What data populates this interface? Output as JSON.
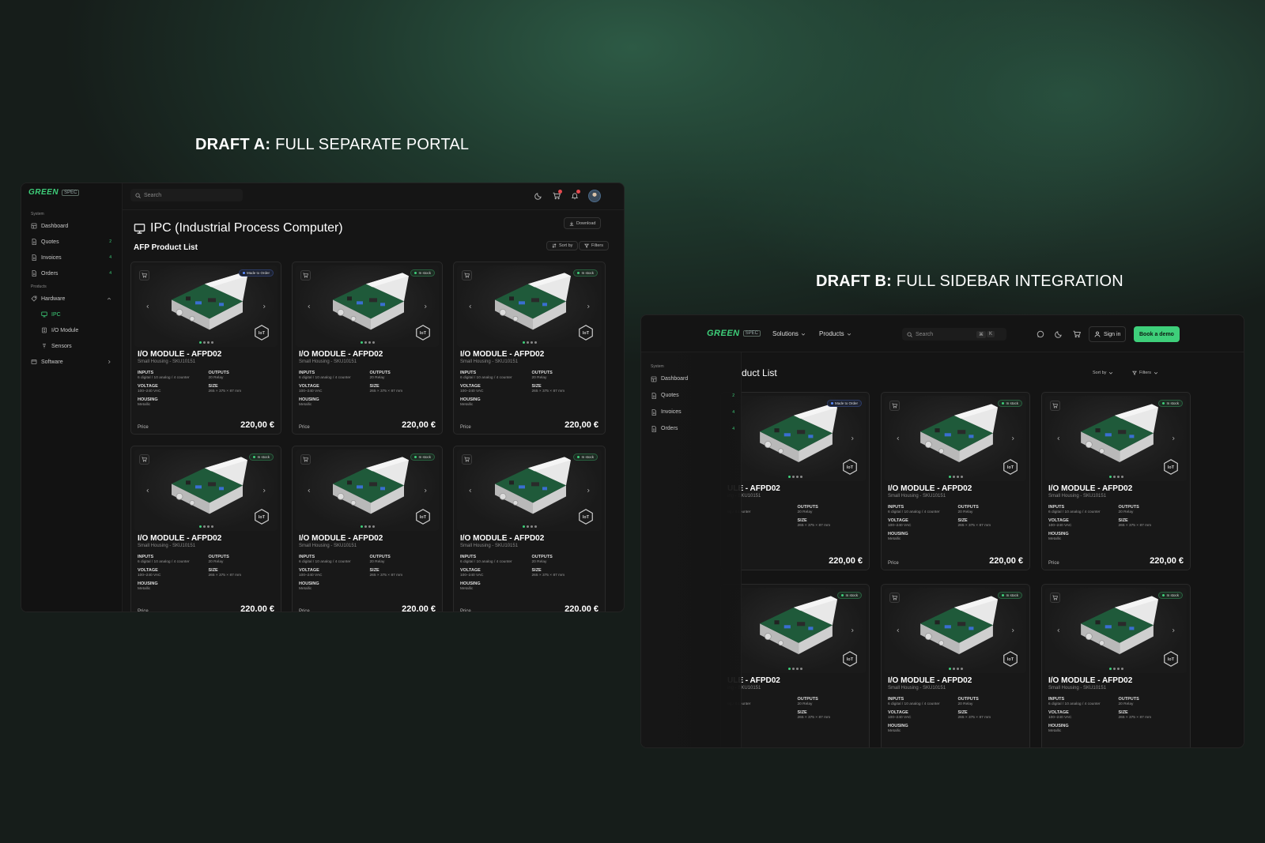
{
  "draft_a": {
    "label": "DRAFT A:",
    "title": "FULL SEPARATE PORTAL"
  },
  "draft_b": {
    "label": "DRAFT B:",
    "title": "FULL SIDEBAR INTEGRATION"
  },
  "brand": {
    "name": "GREEN",
    "tag": "SPEC",
    "accent": "#3ecf7a",
    "alert": "#e5484d"
  },
  "portal": {
    "search_placeholder": "Search",
    "sidebar": {
      "system_label": "System",
      "system_items": [
        {
          "label": "Dashboard",
          "icon": "dashboard-icon",
          "count": ""
        },
        {
          "label": "Quotes",
          "icon": "document-icon",
          "count": "2"
        },
        {
          "label": "Invoices",
          "icon": "document-icon",
          "count": "4"
        },
        {
          "label": "Orders",
          "icon": "document-icon",
          "count": "4"
        }
      ],
      "products_label": "Products",
      "hardware": "Hardware",
      "hardware_children": [
        {
          "label": "IPC",
          "icon": "monitor-icon"
        },
        {
          "label": "I/O Module",
          "icon": "module-icon"
        },
        {
          "label": "Sensors",
          "icon": "sensor-icon"
        }
      ],
      "software": "Software"
    },
    "page_title": "IPC (Industrial Process Computer)",
    "download_label": "Download",
    "list_title": "AFP Product List",
    "sort_label": "Sort by",
    "filters_label": "Filters"
  },
  "integration": {
    "nav": {
      "solutions": "Solutions",
      "products": "Products"
    },
    "search_placeholder": "Search",
    "shortcut": {
      "cmd": "⌘",
      "key": "K"
    },
    "sign_in": "Sign in",
    "book_demo": "Book a demo",
    "list_title_visible": "duct List",
    "sort_label": "Sort by",
    "filters_label": "Filters",
    "sidebar": {
      "system_label": "System",
      "items": [
        {
          "label": "Dashboard",
          "icon": "dashboard-icon",
          "count": ""
        },
        {
          "label": "Quotes",
          "icon": "document-icon",
          "count": "2"
        },
        {
          "label": "Invoices",
          "icon": "document-icon",
          "count": "4"
        },
        {
          "label": "Orders",
          "icon": "document-icon",
          "count": "4"
        }
      ]
    }
  },
  "product": {
    "name": "I/O MODULE - AFPD02",
    "sku": "Small Housing - SKU10151",
    "inputs_label": "INPUTS",
    "inputs": "6 digital / 10 analog / 4 counter",
    "outputs_label": "OUTPUTS",
    "outputs": "20 Relay",
    "voltage_label": "VOLTAGE",
    "voltage": "100–240 VAC",
    "size_label": "SIZE",
    "size": "265 × 375 × 87 mm",
    "housing_label": "HOUSING",
    "housing": "Metallic",
    "price_label": "Price",
    "price": "220,00 €"
  },
  "status": {
    "made_to_order": "Made to Order",
    "in_stock": "In stock"
  },
  "cards_a": [
    "made_to_order",
    "in_stock",
    "in_stock",
    "in_stock",
    "in_stock",
    "in_stock"
  ],
  "cards_b": [
    "made_to_order",
    "in_stock",
    "in_stock",
    "in_stock",
    "in_stock",
    "in_stock"
  ],
  "cards_b_partial": {
    "name": "ULE - AFPD02",
    "sku": "ing - SKU10151",
    "inputs": "og / 4 counter"
  }
}
